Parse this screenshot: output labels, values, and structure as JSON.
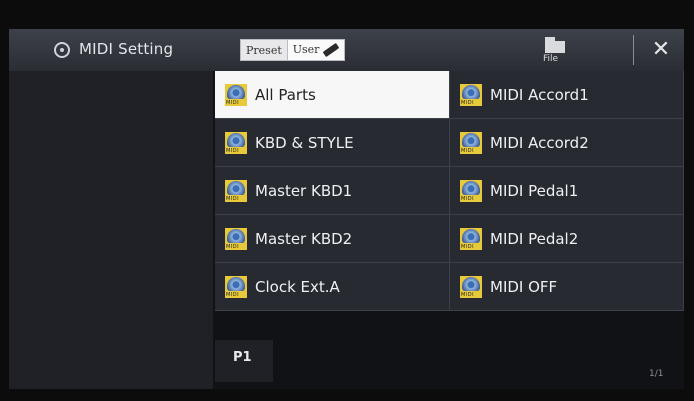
{
  "header": {
    "title": "MIDI Setting",
    "tabs": [
      {
        "label": "Preset"
      },
      {
        "label": "User"
      }
    ],
    "file_label": "File",
    "close_label": "✕"
  },
  "grid": {
    "items": [
      {
        "label": "All Parts",
        "selected": true
      },
      {
        "label": "MIDI Accord1"
      },
      {
        "label": "KBD & STYLE"
      },
      {
        "label": "MIDI Accord2"
      },
      {
        "label": "Master KBD1"
      },
      {
        "label": "MIDI Pedal1"
      },
      {
        "label": "Master KBD2"
      },
      {
        "label": "MIDI Pedal2"
      },
      {
        "label": "Clock Ext.A"
      },
      {
        "label": "MIDI OFF"
      }
    ]
  },
  "footer": {
    "page_tab": "P1",
    "page_count": "1/1"
  },
  "colors": {
    "icon_bg": "#e7c93a",
    "selected_bg": "#f7f7f8",
    "panel_bg": "#272a30",
    "header_bg": "#3d414a"
  }
}
